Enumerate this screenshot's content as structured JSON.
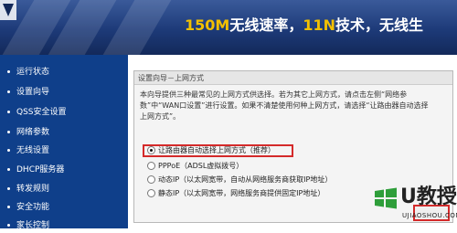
{
  "banner": {
    "slogan_part1": "150M",
    "slogan_part2": "无线速率，",
    "slogan_part3": "11N",
    "slogan_part4": "技术，",
    "slogan_part5": "无线生"
  },
  "sidebar": {
    "items": [
      {
        "label": "运行状态"
      },
      {
        "label": "设置向导"
      },
      {
        "label": "QSS安全设置"
      },
      {
        "label": "网络参数"
      },
      {
        "label": "无线设置"
      },
      {
        "label": "DHCP服务器"
      },
      {
        "label": "转发规则"
      },
      {
        "label": "安全功能"
      },
      {
        "label": "家长控制"
      }
    ]
  },
  "panel": {
    "title": "设置向导－上网方式",
    "description": "本向导提供三种最常见的上网方式供选择。若为其它上网方式，请点击左侧“网络参数”中“WAN口设置”进行设置。如果不清楚使用何种上网方式，请选择“让路由器自动选择上网方式”。",
    "options": [
      {
        "label": "让路由器自动选择上网方式（推荐）",
        "selected": true
      },
      {
        "label": "PPPoE（ADSL虚拟拨号）",
        "selected": false
      },
      {
        "label": "动态IP（以太网宽带，自动从网络服务商获取IP地址）",
        "selected": false
      },
      {
        "label": "静态IP（以太网宽带，网络服务商提供固定IP地址）",
        "selected": false
      }
    ]
  },
  "watermark": {
    "brand": "U教授",
    "site": "UJIAOSHOU.COM"
  },
  "colors": {
    "sidebar_bg": "#0f3f8a",
    "highlight": "#d42a2a",
    "slogan_yellow": "#f2c000"
  }
}
